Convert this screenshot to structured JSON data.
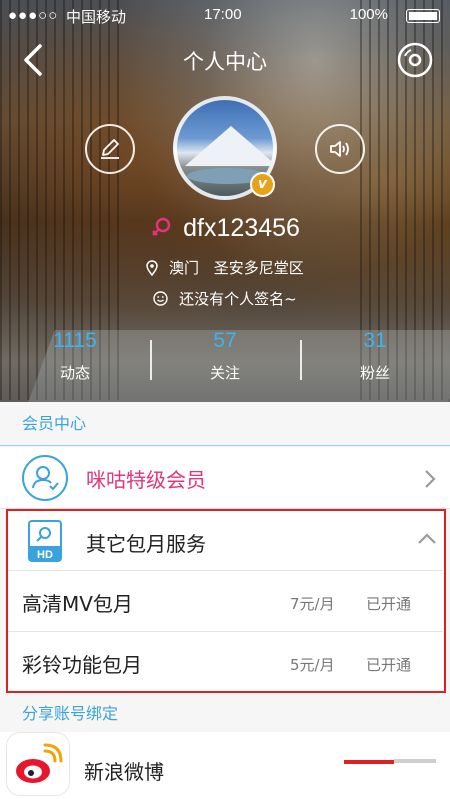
{
  "status_bar": {
    "signal": "●●●○○",
    "carrier": "中国移动",
    "time": "17:00",
    "battery": "100%"
  },
  "nav": {
    "title": "个人中心"
  },
  "profile": {
    "username": "dfx123456",
    "location_city": "澳门",
    "location_district": "圣安多尼堂区",
    "signature": "还没有个人签名~",
    "vip_badge": "v"
  },
  "stats": [
    {
      "value": "1115",
      "label": "动态"
    },
    {
      "value": "57",
      "label": "关注"
    },
    {
      "value": "31",
      "label": "粉丝"
    }
  ],
  "member_section": {
    "header": "会员中心",
    "vip_label": "咪咕特级会员",
    "other_label": "其它包月服务",
    "hd_icon_text": "HD",
    "subscriptions": [
      {
        "name": "高清MV包月",
        "price": "7元/月",
        "status": "已开通"
      },
      {
        "name": "彩铃功能包月",
        "price": "5元/月",
        "status": "已开通"
      }
    ]
  },
  "share_section": {
    "header": "分享账号绑定",
    "weibo_label": "新浪微博"
  },
  "colors": {
    "accent_blue": "#3aa3dd",
    "vip_pink": "#e2347b",
    "highlight_red": "#e02020",
    "stat_blue": "#3cb4f0"
  }
}
